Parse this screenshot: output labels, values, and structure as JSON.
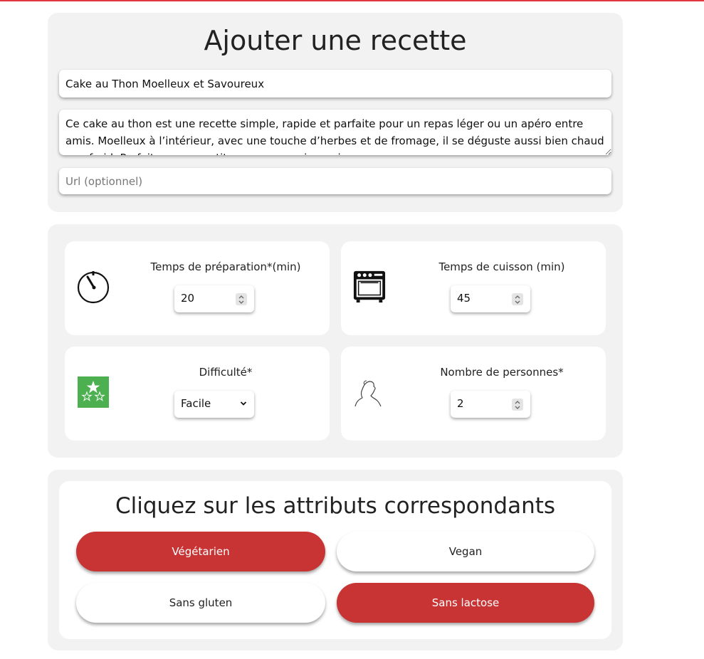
{
  "recipe_form": {
    "title": "Ajouter une recette",
    "name_value": "Cake au Thon Moelleux et Savoureux",
    "description_value": "Ce cake au thon est une recette simple, rapide et parfaite pour un repas léger ou un apéro entre amis. Moelleux à l’intérieur, avec une touche d’herbes et de fromage, il se déguste aussi bien chaud que froid. Parfait pour un petit creux ou un pique-nique.",
    "url_placeholder": "Url (optionnel)"
  },
  "details": {
    "prep": {
      "label": "Temps de préparation*(min)",
      "value": "20",
      "icon": "timer-icon"
    },
    "cook": {
      "label": "Temps de cuisson (min)",
      "value": "45",
      "icon": "oven-icon"
    },
    "difficulty": {
      "label": "Difficulté*",
      "selected": "Facile",
      "level_stars": 1,
      "max_stars": 3,
      "icon": "difficulty-stars-icon",
      "icon_color": "#4caf50"
    },
    "people": {
      "label": "Nombre de personnes*",
      "value": "2",
      "icon": "person-icon"
    }
  },
  "attributes": {
    "title": "Cliquez sur les attributs correspondants",
    "items": [
      {
        "label": "Végétarien",
        "selected": true
      },
      {
        "label": "Vegan",
        "selected": false
      },
      {
        "label": "Sans gluten",
        "selected": false
      },
      {
        "label": "Sans lactose",
        "selected": true
      }
    ]
  },
  "colors": {
    "accent": "#c83434",
    "top_line": "#e0383e",
    "panel_bg": "#f2f2f2"
  }
}
